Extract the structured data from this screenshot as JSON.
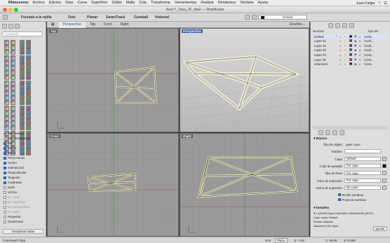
{
  "menubar": {
    "app": "Rhinoceros",
    "items": [
      "Archivo",
      "Edición",
      "Vista",
      "Curva",
      "Superficie",
      "Sólido",
      "Malla",
      "Cota",
      "Transformar",
      "Herramientas",
      "Analizar",
      "Renderizar",
      "Ventana",
      "Ayuda"
    ],
    "user": "Juan Felipe"
  },
  "window": {
    "title": "Ass17_Joya_JF_dia2 — Modificado"
  },
  "toolbar": {
    "tabs": [
      "Forzado a la rejilla",
      "Orto",
      "Planar",
      "SmartTrack",
      "Gumball",
      "Historial"
    ],
    "layer_label": "Default"
  },
  "left": {
    "search_placeholder": "Comando",
    "osnap": [
      {
        "label": "Permanente",
        "on": true,
        "type": "radio"
      },
      {
        "label": "Una designación",
        "on": false,
        "type": "radio"
      },
      {
        "label": "Fin",
        "on": true
      },
      {
        "label": "Cerca",
        "on": true
      },
      {
        "label": "Punto",
        "on": true
      },
      {
        "label": "Punto medio",
        "on": true
      },
      {
        "label": "Centro",
        "on": true
      },
      {
        "label": "Intersección",
        "on": true
      },
      {
        "label": "Perpendicular",
        "on": true
      },
      {
        "label": "Tangente",
        "on": true
      },
      {
        "label": "Cuadrante",
        "on": true
      },
      {
        "label": "Nodo",
        "on": false
      },
      {
        "label": "Vértice",
        "on": false
      },
      {
        "label": "En curva",
        "on": false,
        "dim": true
      },
      {
        "label": "En superficie",
        "on": false,
        "dim": true
      },
      {
        "label": "En polisuperficie",
        "on": false,
        "dim": true
      },
      {
        "label": "En malla",
        "on": false,
        "dim": true
      },
      {
        "label": "Proyectar",
        "on": false
      },
      {
        "label": "SmartTrack",
        "on": false
      }
    ],
    "disable_all": "Desactivar todas"
  },
  "viewport_tabs": [
    "Perspective",
    "Top",
    "Front",
    "Right"
  ],
  "viewport_tabs_right": "Diseños...",
  "viewports": {
    "top": "Top",
    "perspective": "Perspective",
    "front": "Front",
    "right": "Right"
  },
  "layers": {
    "headers": {
      "name": "Nombre",
      "mat": "Tipo de"
    },
    "rows": [
      {
        "name": "Default",
        "color": "#000000",
        "check": true,
        "mat": "Conti..."
      },
      {
        "name": "Layer 01",
        "color": "#d42020",
        "mat": "Conti..."
      },
      {
        "name": "Layer 02",
        "color": "#2a2ad4",
        "mat": "Conti..."
      },
      {
        "name": "Layer 03",
        "color": "#20a020",
        "mat": "Conti..."
      },
      {
        "name": "Layer 04",
        "color": "#2a2ad4",
        "mat": "Conti..."
      },
      {
        "name": "Layer 05",
        "color": "#d420d4",
        "mat": "Conti..."
      },
      {
        "name": "anteriores",
        "color": "#111111",
        "mat": "Conti..."
      }
    ]
  },
  "properties": {
    "section_basic": "Básico",
    "rows": [
      {
        "label": "Tipo de objeto:",
        "value": "open curve"
      },
      {
        "label": "Nombre:",
        "value": ""
      },
      {
        "label": "Capa:",
        "value": "Default"
      },
      {
        "label": "Color de pantalla:",
        "value": "Por capa"
      },
      {
        "label": "Tipo de línea:",
        "value": "Por capa"
      },
      {
        "label": "Color de impresión:",
        "value": "Por capa"
      },
      {
        "label": "Ancho de impresión:",
        "value": "By Layer"
      }
    ],
    "receive_shadows": "Recibe sombras",
    "cast_shadows": "Proyecta sombras",
    "section_details": "Detalles",
    "details": [
      "ID: a2f1f1f9-9ac8-49c8-8981-13e0e0f1096 {46739...",
      "Layer name: Default",
      "Render Material:",
      "Attached to the layer..."
    ],
    "match_button": "Igualar"
  },
  "status": {
    "command": "Command: Pipe",
    "unit": "Unit",
    "plane": "Plano",
    "x": "X: 7.53",
    "y": "Y: 18.08",
    "z": "Z: 0.000"
  }
}
